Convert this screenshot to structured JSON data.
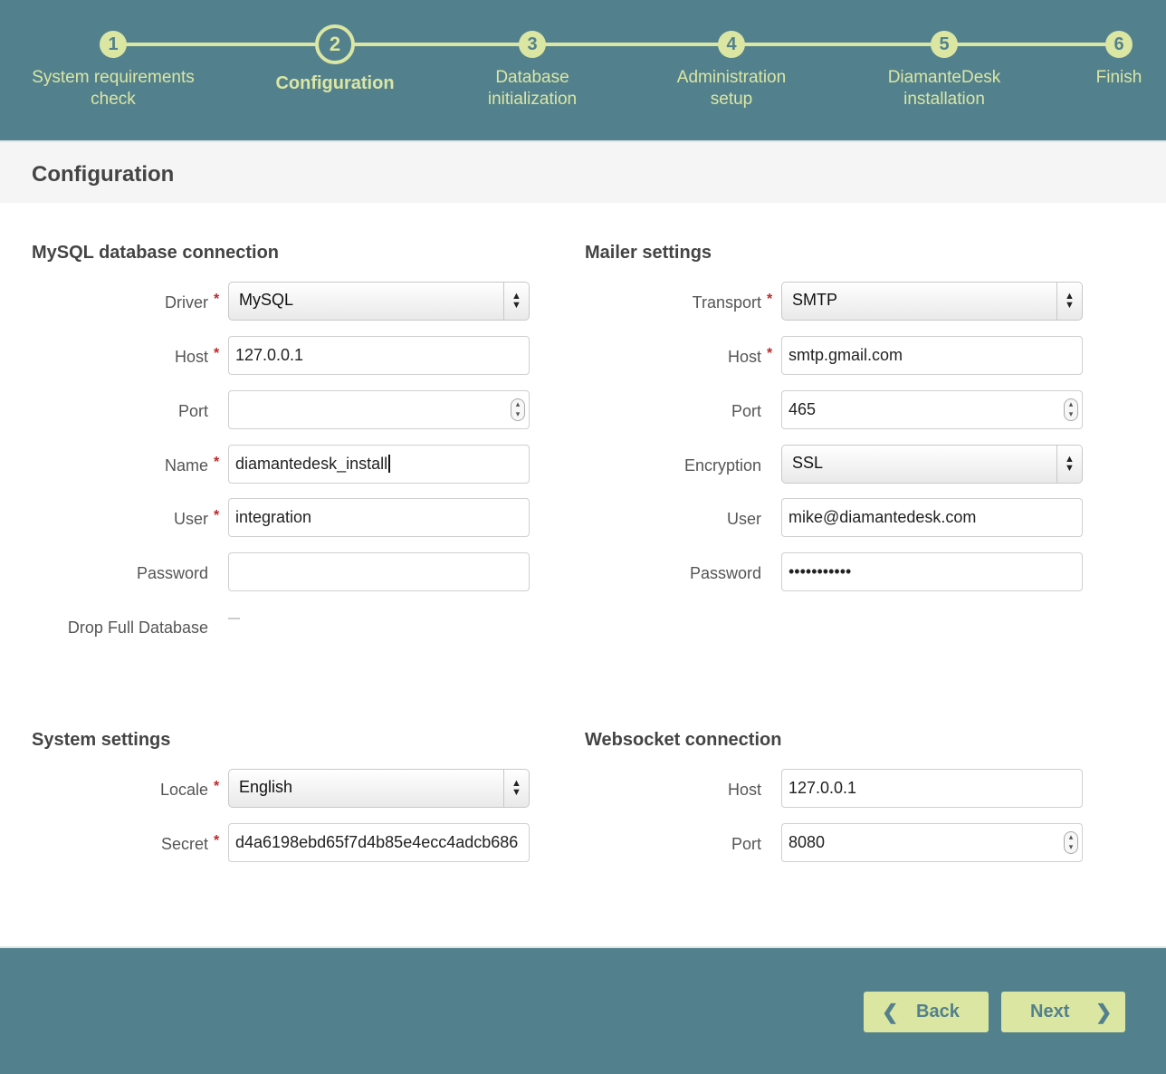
{
  "steps": [
    {
      "number": "1",
      "label_line1": "System requirements",
      "label_line2": "check"
    },
    {
      "number": "2",
      "label_line1": "Configuration",
      "label_line2": ""
    },
    {
      "number": "3",
      "label_line1": "Database",
      "label_line2": "initialization"
    },
    {
      "number": "4",
      "label_line1": "Administration",
      "label_line2": "setup"
    },
    {
      "number": "5",
      "label_line1": "DiamanteDesk",
      "label_line2": "installation"
    },
    {
      "number": "6",
      "label_line1": "Finish",
      "label_line2": ""
    }
  ],
  "page_title": "Configuration",
  "mysql": {
    "title": "MySQL database connection",
    "driver": {
      "label": "Driver",
      "value": "MySQL"
    },
    "host": {
      "label": "Host",
      "value": "127.0.0.1"
    },
    "port": {
      "label": "Port",
      "value": ""
    },
    "name": {
      "label": "Name",
      "value": "diamantedesk_install"
    },
    "user": {
      "label": "User",
      "value": "integration"
    },
    "password": {
      "label": "Password",
      "value": ""
    },
    "drop": {
      "label": "Drop Full Database"
    }
  },
  "mailer": {
    "title": "Mailer settings",
    "transport": {
      "label": "Transport",
      "value": "SMTP"
    },
    "host": {
      "label": "Host",
      "value": "smtp.gmail.com"
    },
    "port": {
      "label": "Port",
      "value": "465"
    },
    "encryption": {
      "label": "Encryption",
      "value": "SSL"
    },
    "user": {
      "label": "User",
      "value": "mike@diamantedesk.com"
    },
    "password": {
      "label": "Password",
      "value": "•••••••••••"
    }
  },
  "system": {
    "title": "System settings",
    "locale": {
      "label": "Locale",
      "value": "English"
    },
    "secret": {
      "label": "Secret",
      "value": "d4a6198ebd65f7d4b85e4ecc4adcb686"
    }
  },
  "websocket": {
    "title": "Websocket connection",
    "host": {
      "label": "Host",
      "value": "127.0.0.1"
    },
    "port": {
      "label": "Port",
      "value": "8080"
    }
  },
  "required_mark": "*",
  "footer": {
    "back_label": "Back",
    "next_label": "Next"
  },
  "colors": {
    "header_bg": "#52818d",
    "accent": "#dbe6a3",
    "required": "#c0282b"
  }
}
